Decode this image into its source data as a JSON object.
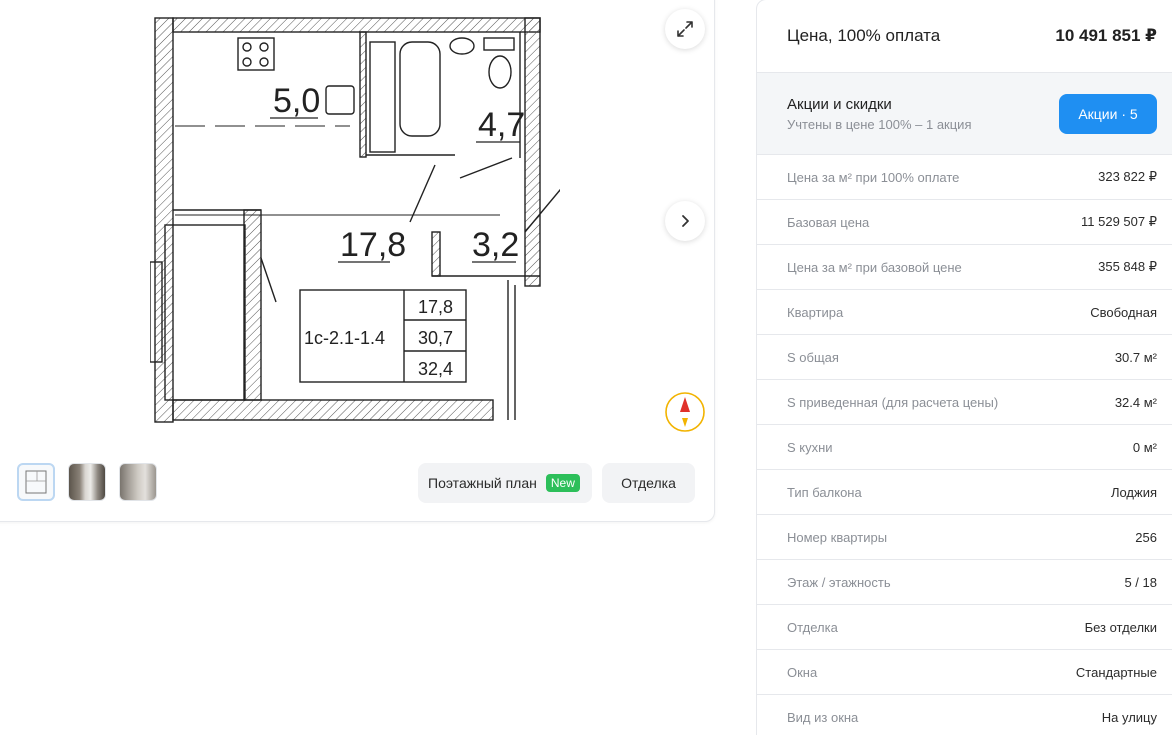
{
  "plan": {
    "room_areas": {
      "kitchen": "5,0",
      "bathroom": "4,7",
      "living": "17,8",
      "hall": "3,2"
    },
    "legend": {
      "code": "1с-2.1-1.4",
      "values": [
        "17,8",
        "30,7",
        "32,4"
      ]
    }
  },
  "controls": {
    "expand_icon": "expand-arrows-icon",
    "next_icon": "chevron-right-icon",
    "compass_icon": "compass-north-icon",
    "floor_plan_label": "Поэтажный план",
    "new_badge": "New",
    "finish_label": "Отделка"
  },
  "thumbnails": [
    {
      "name": "thumb-plan",
      "kind": "plan"
    },
    {
      "name": "thumb-photo-1",
      "kind": "photo"
    },
    {
      "name": "thumb-photo-2",
      "kind": "photo"
    }
  ],
  "price": {
    "label": "Цена, 100% оплата",
    "value": "10 491 851 ₽"
  },
  "promo": {
    "title": "Акции и скидки",
    "subtitle": "Учтены в цене 100% – 1 акция",
    "button": "Акции · 5"
  },
  "params": [
    {
      "label": "Цена за м² при 100% оплате",
      "value": "323 822 ₽"
    },
    {
      "label": "Базовая цена",
      "value": "11 529 507 ₽"
    },
    {
      "label": "Цена за м² при базовой цене",
      "value": "355 848 ₽"
    },
    {
      "label": "Квартира",
      "value": "Свободная"
    },
    {
      "label": "S общая",
      "value": "30.7 м²"
    },
    {
      "label": "S приведенная (для расчета цены)",
      "value": "32.4 м²"
    },
    {
      "label": "S кухни",
      "value": "0 м²"
    },
    {
      "label": "Тип балкона",
      "value": "Лоджия"
    },
    {
      "label": "Номер квартиры",
      "value": "256"
    },
    {
      "label": "Этаж / этажность",
      "value": "5 / 18"
    },
    {
      "label": "Отделка",
      "value": "Без отделки"
    },
    {
      "label": "Окна",
      "value": "Стандартные"
    },
    {
      "label": "Вид из окна",
      "value": "На улицу"
    }
  ],
  "colors": {
    "accent": "#1f8ff2",
    "badge_green": "#2dbf5a",
    "compass_red": "#e0312a",
    "compass_gold": "#f2b300"
  }
}
